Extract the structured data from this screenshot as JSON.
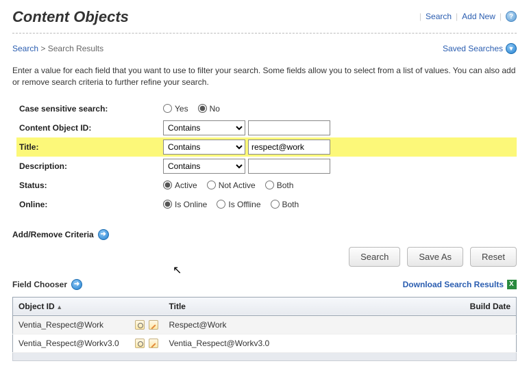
{
  "page": {
    "title": "Content Objects",
    "topLinks": {
      "search": "Search",
      "addNew": "Add New"
    }
  },
  "breadcrumb": {
    "search": "Search",
    "results": "Search Results"
  },
  "savedSearches": "Saved Searches",
  "intro": "Enter a value for each field that you want to use to filter your search. Some fields allow you to select from a list of values. You can also add or remove search criteria to further refine your search.",
  "form": {
    "caseSensitive": {
      "label": "Case sensitive search:",
      "yes": "Yes",
      "no": "No"
    },
    "contentObjectId": {
      "label": "Content Object ID:",
      "operator": "Contains",
      "value": ""
    },
    "title": {
      "label": "Title:",
      "operator": "Contains",
      "value": "respect@work"
    },
    "description": {
      "label": "Description:",
      "operator": "Contains",
      "value": ""
    },
    "status": {
      "label": "Status:",
      "active": "Active",
      "notActive": "Not Active",
      "both": "Both"
    },
    "online": {
      "label": "Online:",
      "isOnline": "Is Online",
      "isOffline": "Is Offline",
      "both": "Both"
    }
  },
  "addRemoveCriteria": "Add/Remove Criteria",
  "buttons": {
    "search": "Search",
    "saveAs": "Save As",
    "reset": "Reset"
  },
  "fieldChooser": "Field Chooser",
  "downloadResults": "Download Search Results",
  "table": {
    "headers": {
      "objectId": "Object ID",
      "title": "Title",
      "buildDate": "Build Date"
    },
    "rows": [
      {
        "objectId": "Ventia_Respect@Work",
        "title": "Respect@Work",
        "buildDate": ""
      },
      {
        "objectId": "Ventia_Respect@Workv3.0",
        "title": "Ventia_Respect@Workv3.0",
        "buildDate": ""
      }
    ]
  }
}
